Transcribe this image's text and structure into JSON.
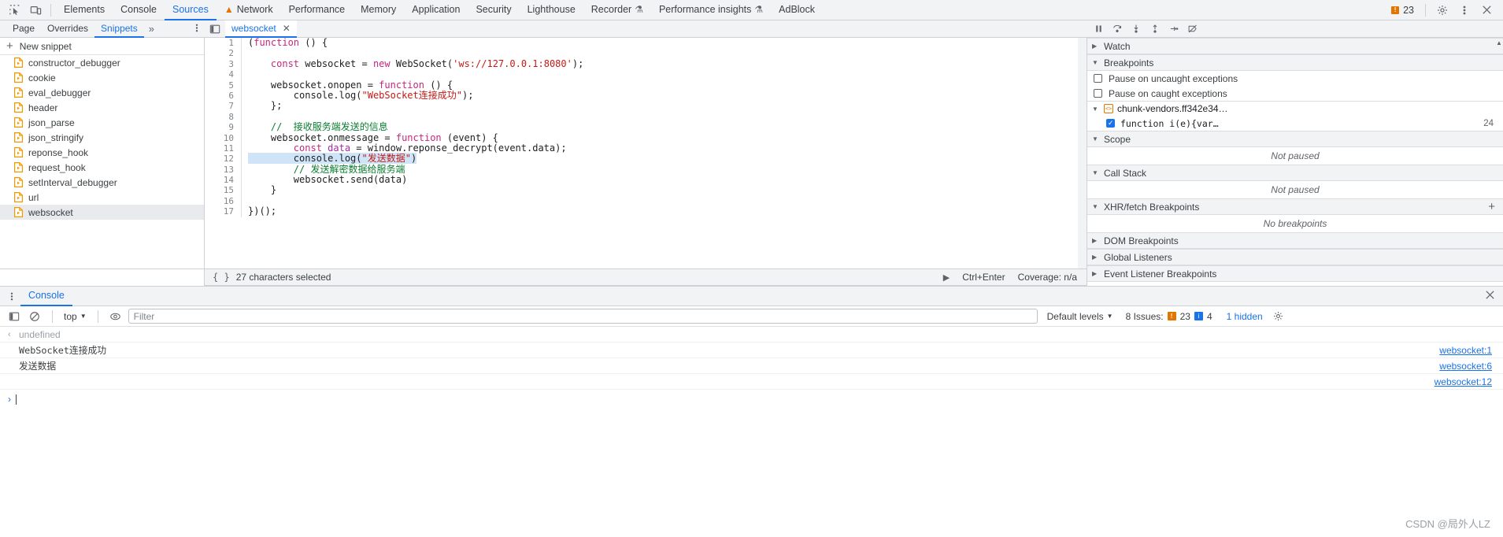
{
  "topbar": {
    "inspect_icon": "inspect-cursor-icon",
    "device_icon": "device-toolbar-icon",
    "tabs": [
      {
        "label": "Elements",
        "active": false,
        "icon": null
      },
      {
        "label": "Console",
        "active": false,
        "icon": null
      },
      {
        "label": "Sources",
        "active": true,
        "icon": null
      },
      {
        "label": "Network",
        "active": false,
        "icon": "warning-triangle-icon"
      },
      {
        "label": "Performance",
        "active": false,
        "icon": null
      },
      {
        "label": "Memory",
        "active": false,
        "icon": null
      },
      {
        "label": "Application",
        "active": false,
        "icon": null
      },
      {
        "label": "Security",
        "active": false,
        "icon": null
      },
      {
        "label": "Lighthouse",
        "active": false,
        "icon": null
      },
      {
        "label": "Recorder",
        "active": false,
        "icon": "flask-icon"
      },
      {
        "label": "Performance insights",
        "active": false,
        "icon": "flask-icon"
      },
      {
        "label": "AdBlock",
        "active": false,
        "icon": null
      }
    ],
    "issue_count": "23",
    "issue_badge_glyph": "!",
    "settings_icon": "gear-icon",
    "more_icon": "kebab-menu-icon",
    "close_icon": "close-icon"
  },
  "navigator": {
    "subtabs": [
      {
        "label": "Page",
        "active": false
      },
      {
        "label": "Overrides",
        "active": false
      },
      {
        "label": "Snippets",
        "active": true
      }
    ],
    "more_label": "»",
    "kebab_icon": "kebab-menu-icon",
    "new_snippet_label": "New snippet",
    "plus_glyph": "+",
    "snippets": [
      {
        "name": "constructor_debugger",
        "selected": false
      },
      {
        "name": "cookie",
        "selected": false
      },
      {
        "name": "eval_debugger",
        "selected": false
      },
      {
        "name": "header",
        "selected": false
      },
      {
        "name": "json_parse",
        "selected": false
      },
      {
        "name": "json_stringify",
        "selected": false
      },
      {
        "name": "reponse_hook",
        "selected": false
      },
      {
        "name": "request_hook",
        "selected": false
      },
      {
        "name": "setInterval_debugger",
        "selected": false
      },
      {
        "name": "url",
        "selected": false
      },
      {
        "name": "websocket",
        "selected": true
      }
    ]
  },
  "editor": {
    "panel_icon": "show-navigator-icon",
    "tab_label": "websocket",
    "tab_close_glyph": "✕",
    "lines": [
      {
        "n": "1",
        "tokens": [
          {
            "t": "(",
            "c": "plain"
          },
          {
            "t": "function",
            "c": "kw"
          },
          {
            "t": " () {",
            "c": "plain"
          }
        ],
        "highlight": false
      },
      {
        "n": "2",
        "tokens": [],
        "highlight": false
      },
      {
        "n": "3",
        "tokens": [
          {
            "t": "    ",
            "c": "plain"
          },
          {
            "t": "const",
            "c": "kw"
          },
          {
            "t": " websocket = ",
            "c": "plain"
          },
          {
            "t": "new",
            "c": "kw"
          },
          {
            "t": " WebSocket(",
            "c": "plain"
          },
          {
            "t": "'ws://127.0.0.1:8080'",
            "c": "str"
          },
          {
            "t": ");",
            "c": "plain"
          }
        ],
        "highlight": false
      },
      {
        "n": "4",
        "tokens": [],
        "highlight": false
      },
      {
        "n": "5",
        "tokens": [
          {
            "t": "    websocket.onopen = ",
            "c": "plain"
          },
          {
            "t": "function",
            "c": "kw"
          },
          {
            "t": " () {",
            "c": "plain"
          }
        ],
        "highlight": false
      },
      {
        "n": "6",
        "tokens": [
          {
            "t": "        console.log(",
            "c": "plain"
          },
          {
            "t": "\"WebSocket连接成功\"",
            "c": "str"
          },
          {
            "t": ");",
            "c": "plain"
          }
        ],
        "highlight": false
      },
      {
        "n": "7",
        "tokens": [
          {
            "t": "    };",
            "c": "plain"
          }
        ],
        "highlight": false
      },
      {
        "n": "8",
        "tokens": [],
        "highlight": false
      },
      {
        "n": "9",
        "tokens": [
          {
            "t": "    ",
            "c": "plain"
          },
          {
            "t": "//  接收服务端发送的信息",
            "c": "cmt"
          }
        ],
        "highlight": false
      },
      {
        "n": "10",
        "tokens": [
          {
            "t": "    websocket.onmessage = ",
            "c": "plain"
          },
          {
            "t": "function",
            "c": "kw"
          },
          {
            "t": " (event) {",
            "c": "plain"
          }
        ],
        "highlight": false
      },
      {
        "n": "11",
        "tokens": [
          {
            "t": "        ",
            "c": "plain"
          },
          {
            "t": "const",
            "c": "kw"
          },
          {
            "t": " data",
            "c": "kw2"
          },
          {
            "t": " = window.reponse_decrypt(event.data);",
            "c": "plain"
          }
        ],
        "highlight": false
      },
      {
        "n": "12",
        "tokens": [
          {
            "t": "        console.log(",
            "c": "plain"
          },
          {
            "t": "\"发送数据\"",
            "c": "str"
          },
          {
            "t": ")",
            "c": "plain"
          }
        ],
        "highlight": true
      },
      {
        "n": "13",
        "tokens": [
          {
            "t": "        ",
            "c": "plain"
          },
          {
            "t": "// 发送解密数据给服务端",
            "c": "cmt"
          }
        ],
        "highlight": false
      },
      {
        "n": "14",
        "tokens": [
          {
            "t": "        websocket.send(data)",
            "c": "plain"
          }
        ],
        "highlight": false
      },
      {
        "n": "15",
        "tokens": [
          {
            "t": "    }",
            "c": "plain"
          }
        ],
        "highlight": false
      },
      {
        "n": "16",
        "tokens": [],
        "highlight": false
      },
      {
        "n": "17",
        "tokens": [
          {
            "t": "})();",
            "c": "plain"
          }
        ],
        "highlight": false
      }
    ]
  },
  "statusbar": {
    "braces_glyph": "{ }",
    "selection_text": "27 characters selected",
    "run_icon": "run-play-icon",
    "shortcut": "Ctrl+Enter",
    "coverage": "Coverage: n/a"
  },
  "debugger": {
    "toolbar_icons": [
      "pause-resume-icon",
      "step-over-icon",
      "step-into-icon",
      "step-out-icon",
      "step-icon",
      "deactivate-breakpoints-icon"
    ],
    "sections": [
      {
        "name": "Watch",
        "expanded": false,
        "plus": false
      },
      {
        "name": "Breakpoints",
        "expanded": true,
        "plus": false
      },
      {
        "name": "Scope",
        "expanded": true,
        "plus": false
      },
      {
        "name": "Call Stack",
        "expanded": true,
        "plus": false
      },
      {
        "name": "XHR/fetch Breakpoints",
        "expanded": true,
        "plus": true
      },
      {
        "name": "DOM Breakpoints",
        "expanded": false,
        "plus": false
      },
      {
        "name": "Global Listeners",
        "expanded": false,
        "plus": false
      },
      {
        "name": "Event Listener Breakpoints",
        "expanded": false,
        "plus": false
      }
    ],
    "pause_uncaught_label": "Pause on uncaught exceptions",
    "pause_uncaught_checked": false,
    "pause_caught_label": "Pause on caught exceptions",
    "pause_caught_checked": false,
    "breakpoint_file": "chunk-vendors.ff342e34…",
    "breakpoint_snippet": "function i(e){var…",
    "breakpoint_line": "24",
    "breakpoint_checked": true,
    "scope_empty": "Not paused",
    "callstack_empty": "Not paused",
    "xhr_empty": "No breakpoints",
    "plus_glyph": "+"
  },
  "drawer": {
    "kebab_icon": "kebab-menu-icon",
    "tab_label": "Console",
    "close_glyph": "✕",
    "sidebar_icon": "console-sidebar-icon",
    "clear_icon": "clear-console-icon",
    "context": "top",
    "eye_icon": "live-expression-icon",
    "filter_placeholder": "Filter",
    "filter_value": "",
    "levels_label": "Default levels",
    "issues_label": "8 Issues:",
    "issues_error_count": "23",
    "issues_info_count": "4",
    "hidden_label": "1 hidden",
    "settings_icon": "gear-icon",
    "messages": [
      {
        "arrow": "‹",
        "text": "undefined",
        "muted": true,
        "source": ""
      },
      {
        "arrow": "",
        "text": "WebSocket连接成功",
        "muted": false,
        "source": "websocket:1"
      },
      {
        "arrow": "",
        "text": "发送数据",
        "muted": false,
        "source": "websocket:6"
      },
      {
        "arrow": "",
        "text": "",
        "muted": false,
        "source": "websocket:12"
      }
    ],
    "prompt_arrow": "›",
    "prompt_value": ""
  },
  "watermark": "CSDN @局外人LZ",
  "colors": {
    "accent": "#1a73e8",
    "warning": "#e37400",
    "toolbar_bg": "#f1f3f4",
    "selection": "#cfe4f7",
    "string": "#c41a16",
    "comment": "#0b7e2f",
    "keyword": "#c5267f"
  }
}
